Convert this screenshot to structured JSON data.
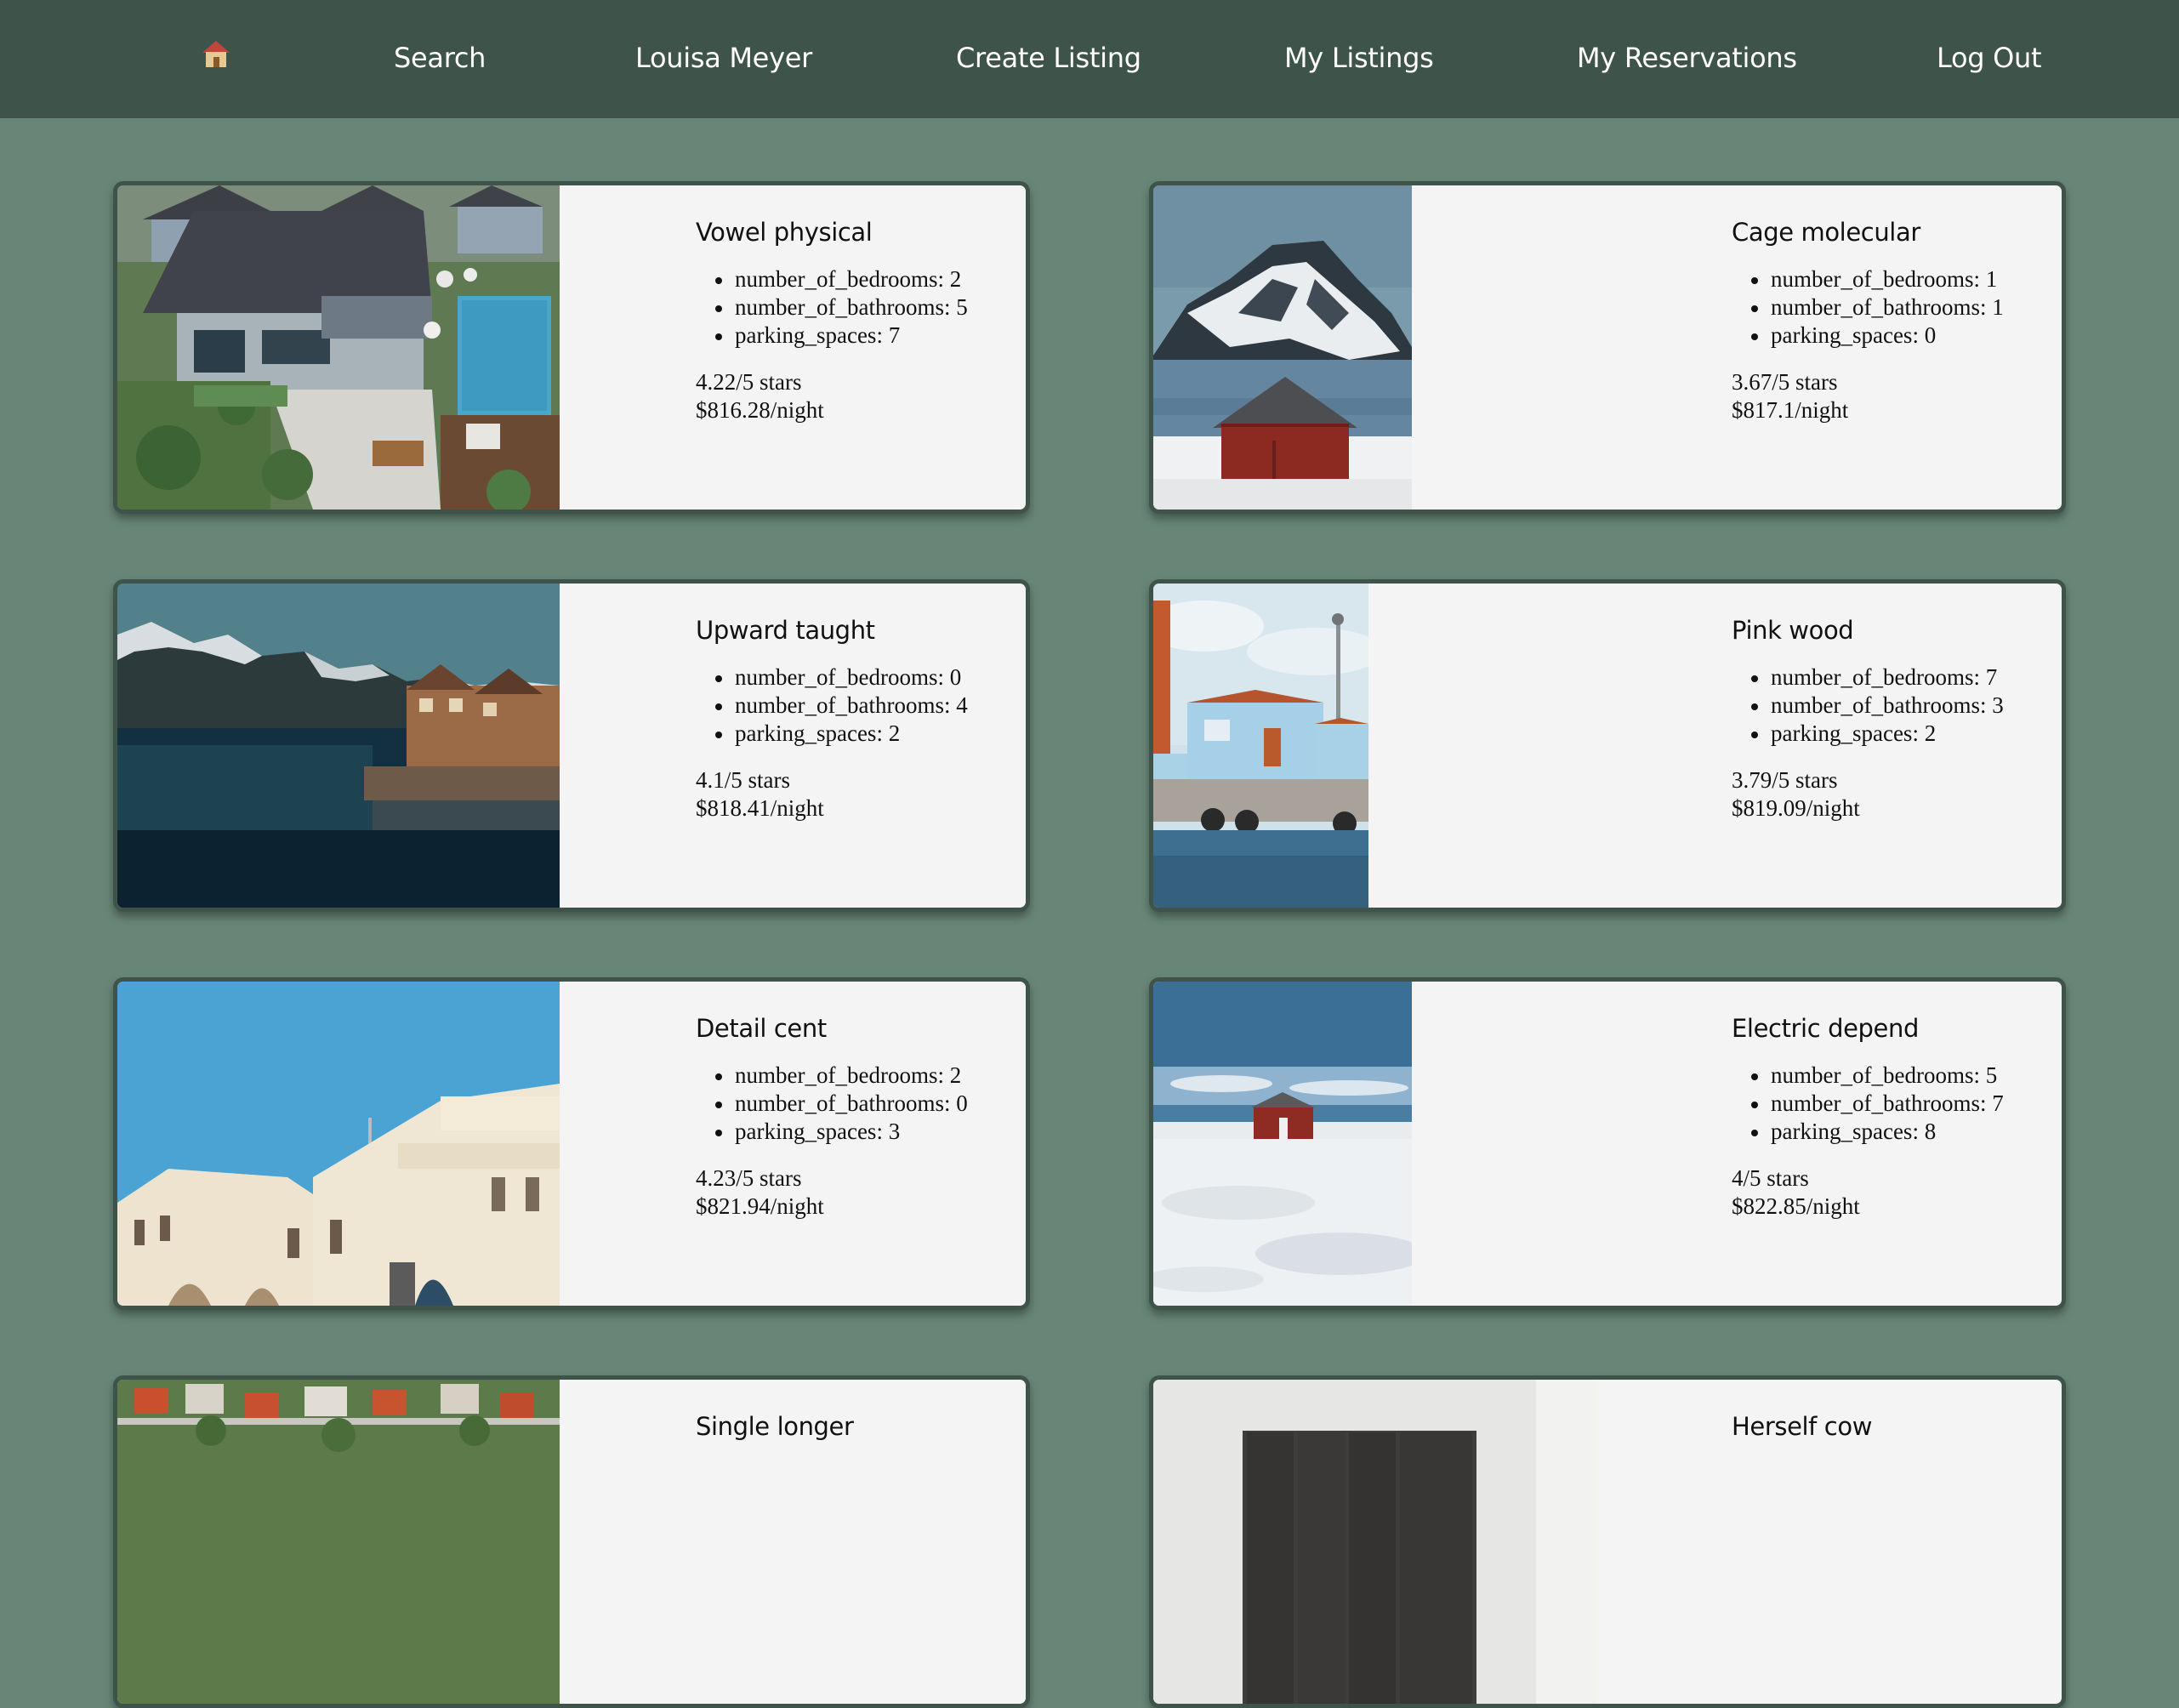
{
  "nav": {
    "home_icon": "house-icon",
    "search": "Search",
    "user": "Louisa Meyer",
    "create": "Create Listing",
    "my_listings": "My Listings",
    "my_reservations": "My Reservations",
    "logout": "Log Out"
  },
  "colors": {
    "navbar": "#3e5349",
    "background": "#688677",
    "card": "#f4f4f4",
    "card_border": "#3e5349"
  },
  "listings": [
    {
      "title": "Vowel physical",
      "bedrooms": "number_of_bedrooms: 2",
      "bathrooms": "number_of_bathrooms: 5",
      "parking": "parking_spaces: 7",
      "stars": "4.22/5 stars",
      "price": "$816.28/night",
      "image": "villa-pool-aerial"
    },
    {
      "title": "Cage molecular",
      "bedrooms": "number_of_bedrooms: 1",
      "bathrooms": "number_of_bathrooms: 1",
      "parking": "parking_spaces: 0",
      "stars": "3.67/5 stars",
      "price": "$817.1/night",
      "image": "red-cabin-mountain"
    },
    {
      "title": "Upward taught",
      "bedrooms": "number_of_bedrooms: 0",
      "bathrooms": "number_of_bathrooms: 4",
      "parking": "parking_spaces: 2",
      "stars": "4.1/5 stars",
      "price": "$818.41/night",
      "image": "lake-village-mountains"
    },
    {
      "title": "Pink wood",
      "bedrooms": "number_of_bedrooms: 7",
      "bathrooms": "number_of_bathrooms: 3",
      "parking": "parking_spaces: 2",
      "stars": "3.79/5 stars",
      "price": "$819.09/night",
      "image": "blue-harbor-house"
    },
    {
      "title": "Detail cent",
      "bedrooms": "number_of_bedrooms: 2",
      "bathrooms": "number_of_bathrooms: 0",
      "parking": "parking_spaces: 3",
      "stars": "4.23/5 stars",
      "price": "$821.94/night",
      "image": "white-arched-building"
    },
    {
      "title": "Electric depend",
      "bedrooms": "number_of_bedrooms: 5",
      "bathrooms": "number_of_bathrooms: 7",
      "parking": "parking_spaces: 8",
      "stars": "4/5 stars",
      "price": "$822.85/night",
      "image": "red-hut-snow-beach"
    },
    {
      "title": "Single longer",
      "image": "town-aerial"
    },
    {
      "title": "Herself cow",
      "image": "dark-kitchen-interior"
    }
  ]
}
